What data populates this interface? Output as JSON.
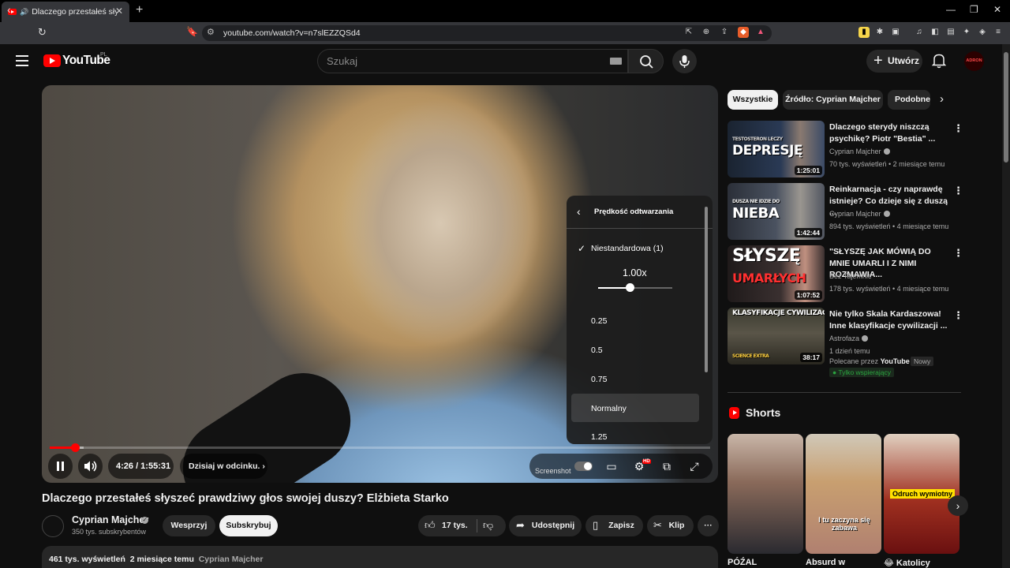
{
  "browser": {
    "tab_title": "Dlaczego przestałeś słyszeć p",
    "url": "youtube.com/watch?v=n7slEZZQSd4"
  },
  "header": {
    "logo_text": "YouTube",
    "country_code": "PL",
    "search_placeholder": "Szukaj",
    "create_label": "Utwórz",
    "avatar_text": "ADRON"
  },
  "player": {
    "current_time": "4:26",
    "duration": "1:55:31",
    "time_display": "4:26 / 1:55:31",
    "progress_fraction": 0.0384,
    "chapter_label": "Dzisiaj w odcinku.",
    "screenshot_label": "Screenshot",
    "hd_badge": "HD"
  },
  "speed_menu": {
    "title": "Prędkość odtwarzania",
    "custom_label": "Niestandardowa (1)",
    "custom_value": "1.00x",
    "slider_level": 0.43,
    "options": [
      "0.25",
      "0.5",
      "0.75",
      "Normalny",
      "1.25"
    ],
    "highlighted": "Normalny"
  },
  "video": {
    "title": "Dlaczego przestałeś słyszeć prawdziwy głos swojej duszy? Elżbieta Starko",
    "channel": "Cyprian Majcher",
    "subscribers": "350 tys. subskrybentów",
    "join_label": "Wesprzyj",
    "subscribe_label": "Subskrybuj",
    "likes": "17 tys.",
    "share_label": "Udostępnij",
    "save_label": "Zapisz",
    "clip_label": "Klip",
    "views": "461 tys. wyświetleń",
    "age": "2 miesiące temu",
    "desc_channel": "Cyprian Majcher"
  },
  "chips": [
    "Wszystkie",
    "Źródło: Cyprian Majcher",
    "Podobne"
  ],
  "recommendations": [
    {
      "title": "Dlaczego sterydy niszczą psychikę? Piotr \"Bestia\" ...",
      "channel": "Cyprian Majcher",
      "meta": "70 tys. wyświetleń • 2 miesiące temu",
      "duration": "1:25:01",
      "thumb_text_1": "TESTOSTERON LECZY",
      "thumb_text_2": "DEPRESJĘ"
    },
    {
      "title": "Reinkarnacja - czy naprawdę istnieje? Co dzieje się z duszą ...",
      "channel": "Cyprian Majcher",
      "meta": "894 tys. wyświetleń • 4 miesiące temu",
      "duration": "1:42:44",
      "thumb_text_1": "DUSZA NIE IDZIE DO",
      "thumb_text_2": "NIEBA"
    },
    {
      "title": "\"SŁYSZĘ JAK MÓWIĄ DO MNIE UMARLI I Z NIMI ROZMAWIA...",
      "channel": "Bez Tajemnic",
      "meta": "178 tys. wyświetleń • 4 miesiące temu",
      "duration": "1:07:52",
      "thumb_text_1": "SŁYSZĘ",
      "thumb_text_2": "UMARŁYCH"
    },
    {
      "title": "Nie tylko Skala Kardaszowa! Inne klasyfikacje cywilizacji ...",
      "channel": "Astrofaza",
      "meta": "1 dzień temu",
      "duration": "38:17",
      "thumb_text_1": "KLASYFIKACJE CYWILIZACJI",
      "thumb_text_2": "SCIENCE EXTRA"
    }
  ],
  "promo": {
    "prefix": "Polecane przez",
    "brand": "YouTube",
    "new_badge": "Nowy",
    "supporter_badge": "Tylko wspierający"
  },
  "shorts": {
    "title": "Shorts",
    "items": [
      {
        "title": "PÓŹAL"
      },
      {
        "title": "Absurd w",
        "caption": "I tu zaczyna się zabawa"
      },
      {
        "title": "😂 Katolicy",
        "caption": "Odruch wymiotny"
      }
    ]
  }
}
